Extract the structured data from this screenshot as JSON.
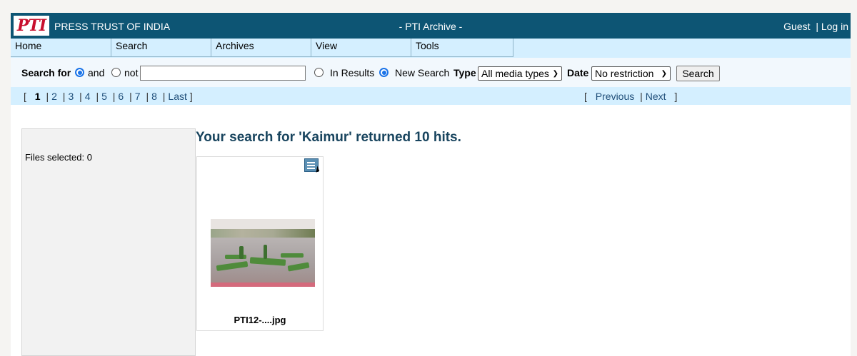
{
  "header": {
    "logo_text": "PTI",
    "brand": "PRESS TRUST OF INDIA",
    "title": "- PTI Archive -",
    "user": "Guest",
    "separator": "|",
    "login": "Log in"
  },
  "menu": {
    "items": [
      "Home",
      "Search",
      "Archives",
      "View",
      "Tools"
    ]
  },
  "search": {
    "label": "Search for",
    "and_label": "and",
    "not_label": "not",
    "query_value": "",
    "in_results_label": "In Results",
    "new_search_label": "New Search",
    "type_label": "Type",
    "type_value": "All media types",
    "date_label": "Date",
    "date_value": "No restriction",
    "button_label": "Search"
  },
  "pager": {
    "open": "[",
    "close": "]",
    "pages": [
      "1",
      "2",
      "3",
      "4",
      "5",
      "6",
      "7",
      "8"
    ],
    "current": "1",
    "last": "Last",
    "previous": "Previous",
    "next": "Next"
  },
  "sidebar": {
    "files_selected": "Files selected: 0"
  },
  "results": {
    "heading": "Your search for 'Kaimur' returned 10 hits.",
    "items": [
      {
        "filename": "PTI12-....jpg"
      }
    ]
  },
  "colors": {
    "header_bg": "#0d5574",
    "menu_bg": "#d4efff",
    "heading_color": "#18445e",
    "logo_red": "#c8102e"
  }
}
